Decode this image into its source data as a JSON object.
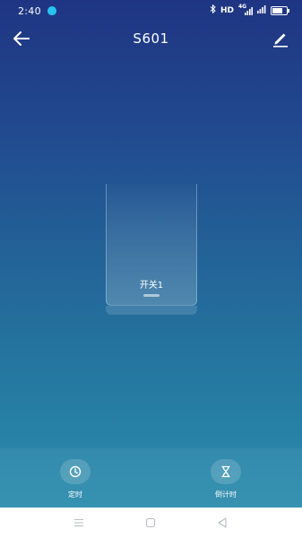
{
  "status_bar": {
    "time": "2:40",
    "hd_label": "HD",
    "signal_label": "4G"
  },
  "header": {
    "title": "S601"
  },
  "switch": {
    "label": "开关1"
  },
  "controls": {
    "timer_label": "定时",
    "countdown_label": "倒计时"
  },
  "icons": {
    "back": "arrow-left-icon",
    "edit": "pencil-icon",
    "timer": "clock-icon",
    "countdown": "hourglass-icon",
    "nav_menu": "menu-icon",
    "nav_home": "home-icon",
    "nav_back": "back-triangle-icon"
  },
  "colors": {
    "gradient_top": "#1f3583",
    "gradient_bottom": "#2a8cad",
    "status_accent": "#27c4f0"
  }
}
